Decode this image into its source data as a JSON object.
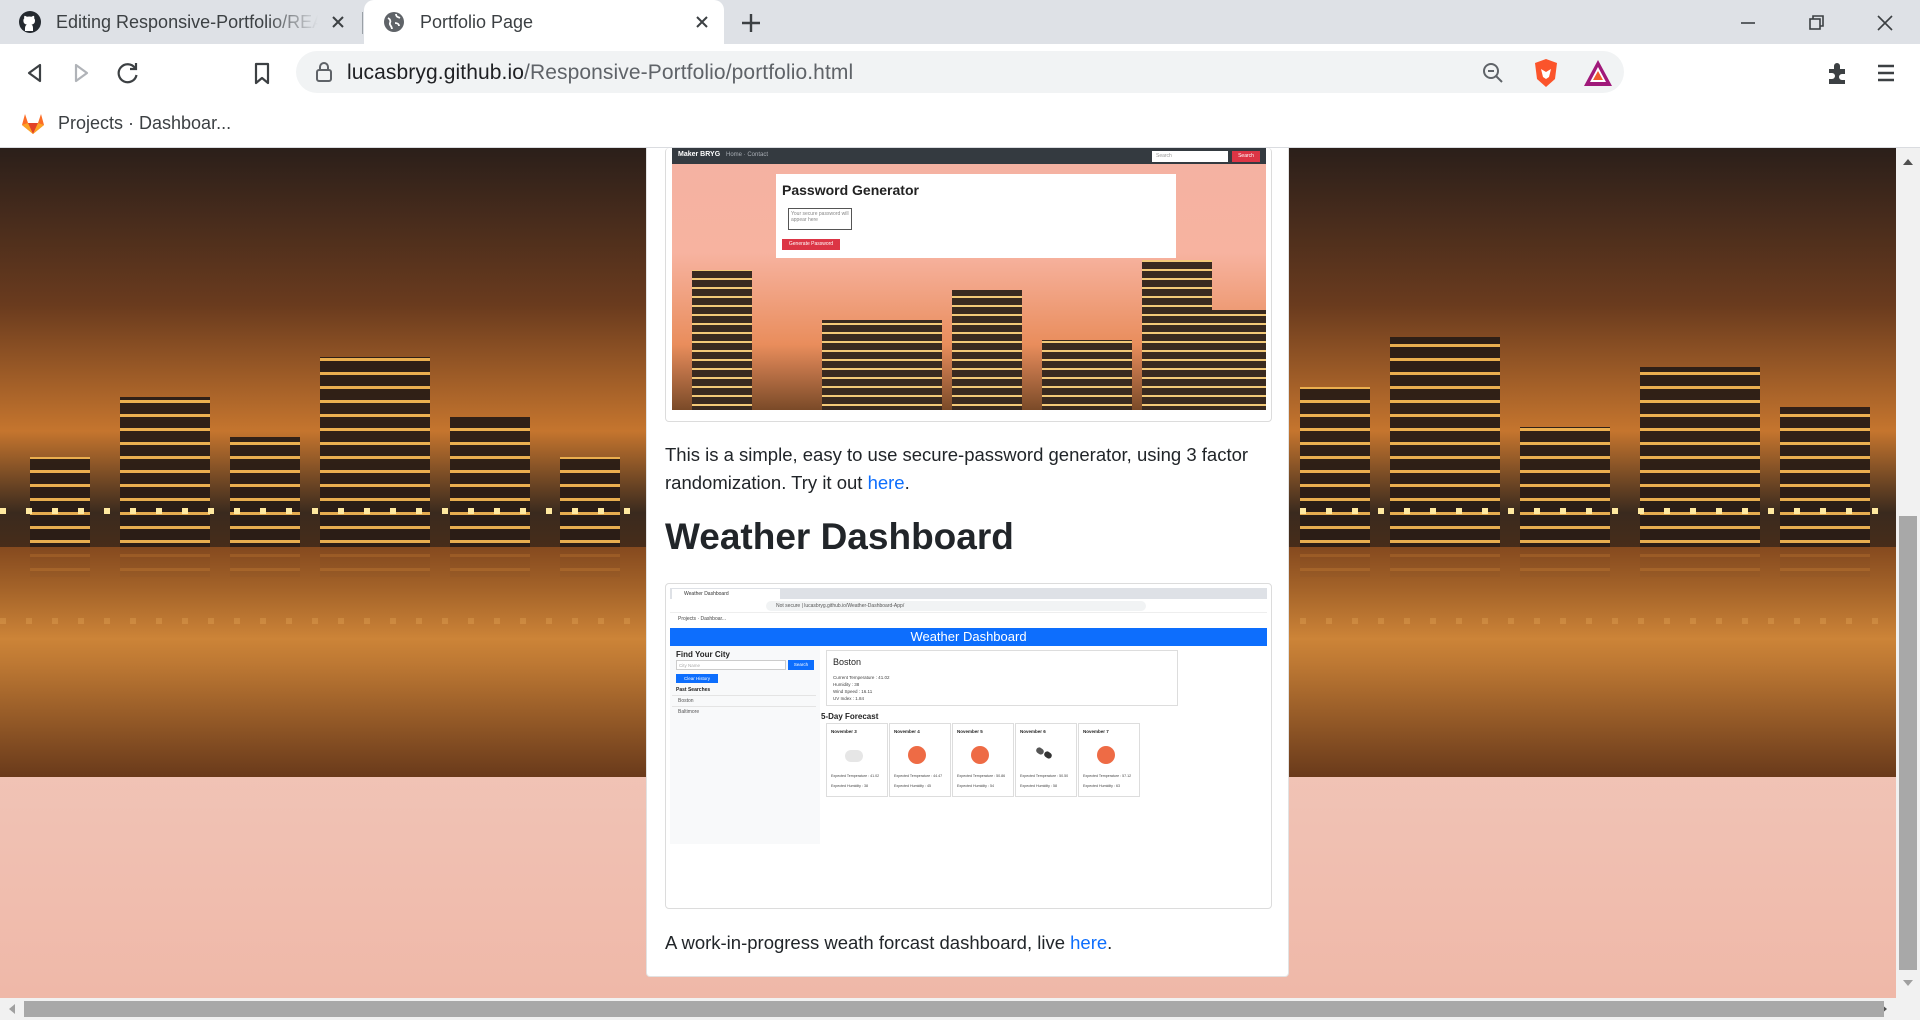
{
  "browser": {
    "tabs": [
      {
        "title": "Editing Responsive-Portfolio/README.md",
        "icon": "github-icon",
        "active": false
      },
      {
        "title": "Portfolio Page",
        "icon": "globe-icon",
        "active": true
      }
    ],
    "url": {
      "host": "lucasbryg.github.io",
      "path": "/Responsive-Portfolio/portfolio.html"
    },
    "bookmarks": [
      {
        "label": "Projects · Dashboar...",
        "icon": "gitlab-icon"
      }
    ],
    "accent": "#0d6efd"
  },
  "project1": {
    "screenshot": {
      "brand": "Maker BRYG",
      "links": "Home · Contact",
      "search_placeholder": "Search",
      "search_button": "Search",
      "title": "Password Generator",
      "textarea_placeholder": "Your secure password will appear here",
      "generate_button": "Generate Password"
    },
    "description": "This is a simple, easy to use secure-password generator, using 3 factor randomization. Try it out ",
    "link": "here",
    "after": "."
  },
  "project2": {
    "heading": "Weather Dashboard",
    "screenshot": {
      "tab": "Weather Dashboard",
      "url": "Not secure  |  lucasbryg.github.io/Weather-Dashboard-App/",
      "bookmark": "Projects · Dashboar...",
      "banner": "Weather Dashboard",
      "find_title": "Find Your City",
      "city_placeholder": "City Name",
      "search_button": "Search",
      "clear_button": "Clear History",
      "past_title": "Past Searches",
      "past": [
        "Boston",
        "Baltimore"
      ],
      "city": "Boston",
      "current": [
        "Current Temperature : 41.02",
        "Humidity : 38",
        "Wind Speed : 16.11",
        "UV Index : 1.84"
      ],
      "forecast_title": "5-Day Forecast",
      "forecast": [
        {
          "date": "November 3",
          "icon": "cloud-icon",
          "temp": "Expected Temperature : 41.02",
          "hum": "Expected Humidity : 38"
        },
        {
          "date": "November 4",
          "icon": "sun-icon",
          "temp": "Expected Temperature : 44.47",
          "hum": "Expected Humidity : 45"
        },
        {
          "date": "November 5",
          "icon": "sun-icon",
          "temp": "Expected Temperature : 50.86",
          "hum": "Expected Humidity : 54"
        },
        {
          "date": "November 6",
          "icon": "storm-icon",
          "temp": "Expected Temperature : 50.50",
          "hum": "Expected Humidity : 58"
        },
        {
          "date": "November 7",
          "icon": "sun-icon",
          "temp": "Expected Temperature : 57.12",
          "hum": "Expected Humidity : 63"
        }
      ]
    },
    "description": "A work-in-progress weath forcast dashboard, live ",
    "link": "here",
    "after": "."
  }
}
